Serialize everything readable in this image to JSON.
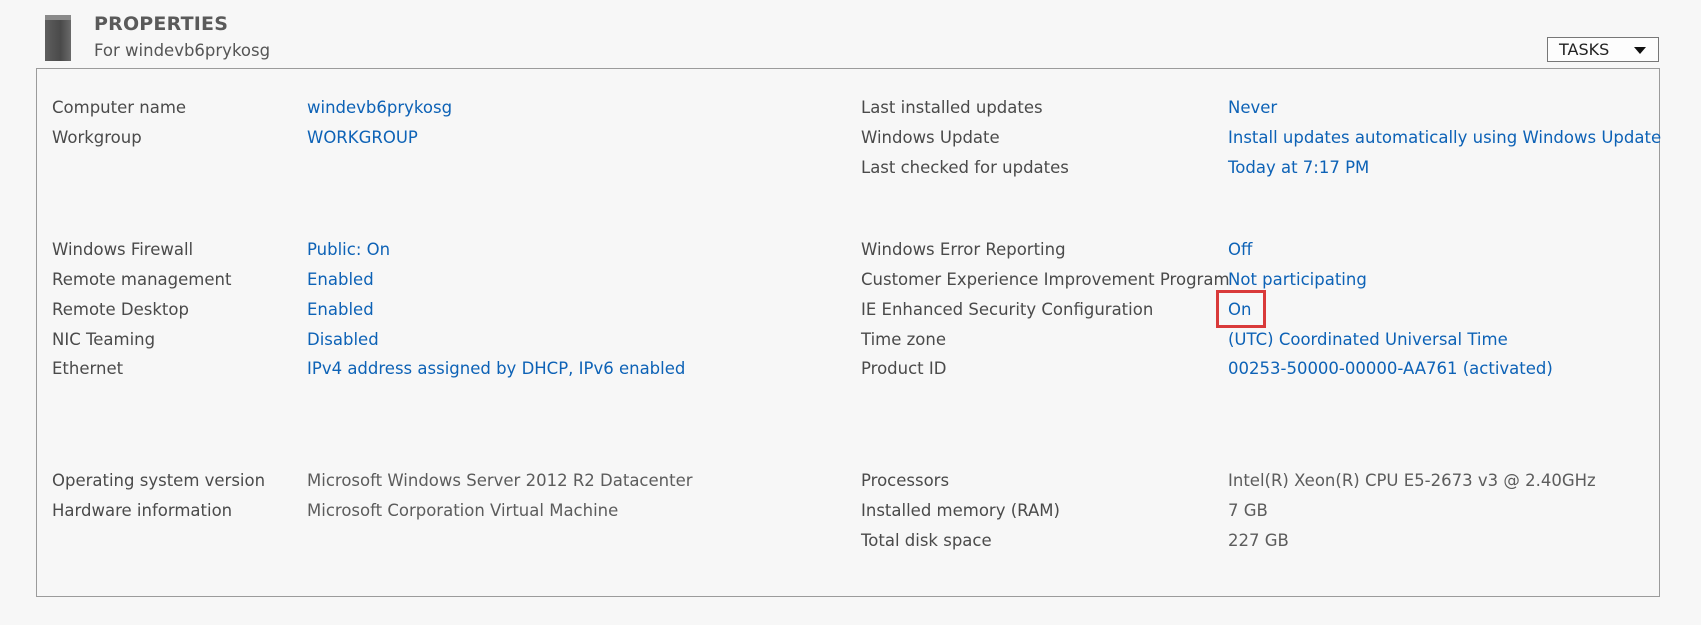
{
  "header": {
    "title": "PROPERTIES",
    "subtitle": "For windevb6prykosg",
    "icon": "server-icon"
  },
  "tasks": {
    "label": "TASKS",
    "icon": "chevron-down-icon"
  },
  "colors": {
    "link": "#0d62b6",
    "highlight": "#d93a3a"
  },
  "left": {
    "computer_name": {
      "label": "Computer name",
      "value": "windevb6prykosg"
    },
    "workgroup": {
      "label": "Workgroup",
      "value": "WORKGROUP"
    },
    "windows_firewall": {
      "label": "Windows Firewall",
      "value": "Public: On"
    },
    "remote_management": {
      "label": "Remote management",
      "value": "Enabled"
    },
    "remote_desktop": {
      "label": "Remote Desktop",
      "value": "Enabled"
    },
    "nic_teaming": {
      "label": "NIC Teaming",
      "value": "Disabled"
    },
    "ethernet": {
      "label": "Ethernet",
      "value": "IPv4 address assigned by DHCP, IPv6 enabled"
    },
    "os_version": {
      "label": "Operating system version",
      "value": "Microsoft Windows Server 2012 R2 Datacenter"
    },
    "hardware_info": {
      "label": "Hardware information",
      "value": "Microsoft Corporation Virtual Machine"
    }
  },
  "right": {
    "last_installed_updates": {
      "label": "Last installed updates",
      "value": "Never"
    },
    "windows_update": {
      "label": "Windows Update",
      "value": "Install updates automatically using Windows Update"
    },
    "last_checked": {
      "label": "Last checked for updates",
      "value": "Today at 7:17 PM"
    },
    "error_reporting": {
      "label": "Windows Error Reporting",
      "value": "Off"
    },
    "ceip": {
      "label": "Customer Experience Improvement Program",
      "value": "Not participating"
    },
    "ie_esc": {
      "label": "IE Enhanced Security Configuration",
      "value": "On"
    },
    "time_zone": {
      "label": "Time zone",
      "value": "(UTC) Coordinated Universal Time"
    },
    "product_id": {
      "label": "Product ID",
      "value": "00253-50000-00000-AA761 (activated)"
    },
    "processors": {
      "label": "Processors",
      "value": "Intel(R) Xeon(R) CPU E5-2673 v3 @ 2.40GHz"
    },
    "ram": {
      "label": "Installed memory (RAM)",
      "value": "7 GB"
    },
    "disk": {
      "label": "Total disk space",
      "value": "227 GB"
    }
  }
}
